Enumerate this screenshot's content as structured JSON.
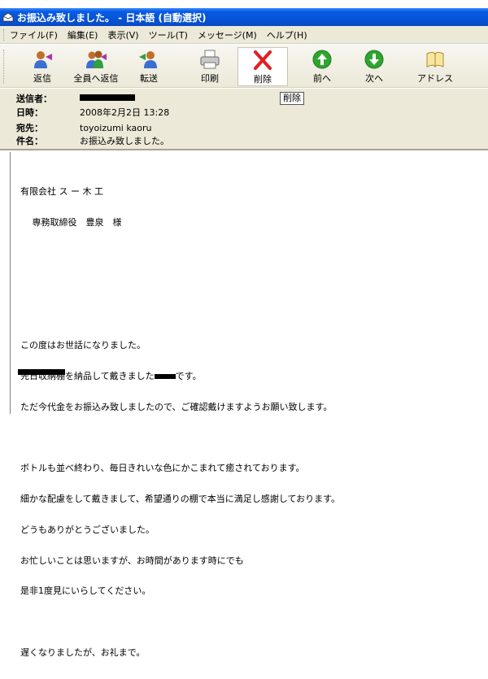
{
  "window": {
    "title": "お振込み致しました。 - 日本語 (自動選択)"
  },
  "menu": [
    "ファイル(F)",
    "編集(E)",
    "表示(V)",
    "ツール(T)",
    "メッセージ(M)",
    "ヘルプ(H)"
  ],
  "toolbar": {
    "reply": "返信",
    "reply_all": "全員へ返信",
    "forward": "転送",
    "print": "印刷",
    "delete": "削除",
    "previous": "前へ",
    "next": "次へ",
    "address": "アドレス"
  },
  "header": {
    "from_label": "送信者：",
    "date_label": "日時：",
    "date_value": "2008年2月2日 13:28",
    "to_label": "宛先：",
    "to_value": "toyoizumi kaoru",
    "subject_label": "件名：",
    "subject_value": "お振込み致しました。",
    "delete_chip": "削除"
  },
  "body": {
    "lines": [
      "有限会社 ス ー 木 工",
      "　 専務取締役　豊泉　様",
      "",
      "",
      "",
      "この度はお世話になりました。",
      "先日収納棚を納品して戴きました",
      "ただ今代金をお振込み致しましたので、ご確認戴けますようお願い致します。",
      "",
      "ボトルも並べ終わり、毎日きれいな色にかこまれて癒されております。",
      "細かな配慮をして戴きまして、希望通りの棚で本当に満足し感謝しております。",
      "どうもありがとうございました。",
      "お忙しいことは思いますが、お時間があります時にでも",
      "是非1度見にいらしてください。",
      "",
      "遅くなりましたが、お礼まで。"
    ],
    "line7_suffix": "です。"
  },
  "colors": {
    "titlebar": "#0553d6",
    "chrome": "#ece9d8",
    "delete_red": "#e02020",
    "nav_green": "#2fa52f"
  }
}
